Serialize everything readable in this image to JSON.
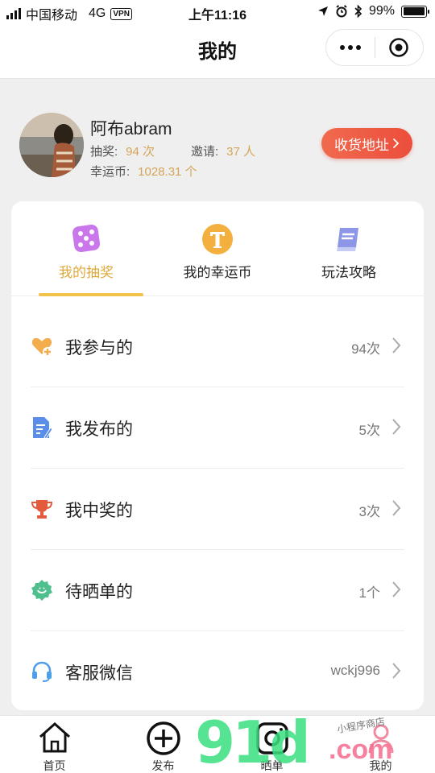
{
  "status_bar": {
    "carrier": "中国移动",
    "network": "4G",
    "vpn": "VPN",
    "time": "上午11:16",
    "battery": "99%",
    "battery_level": 0.99
  },
  "navbar": {
    "title": "我的"
  },
  "profile": {
    "name": "阿布abram",
    "draws_label": "抽奖:",
    "draws_value": "94 次",
    "invites_label": "邀请:",
    "invites_value": "37 人",
    "coins_label": "幸运币:",
    "coins_value": "1028.31 个",
    "address_button": "收货地址"
  },
  "tabs": [
    {
      "label": "我的抽奖",
      "icon": "dice-icon",
      "active": true
    },
    {
      "label": "我的幸运币",
      "icon": "coin-t-icon",
      "active": false
    },
    {
      "label": "玩法攻略",
      "icon": "book-icon",
      "active": false
    }
  ],
  "rows": [
    {
      "label": "我参与的",
      "value": "94次",
      "icon": "heart-plus-icon"
    },
    {
      "label": "我发布的",
      "value": "5次",
      "icon": "document-edit-icon"
    },
    {
      "label": "我中奖的",
      "value": "3次",
      "icon": "trophy-icon"
    },
    {
      "label": "待晒单的",
      "value": "1个",
      "icon": "smile-badge-icon"
    },
    {
      "label": "客服微信",
      "value": "wckj996",
      "icon": "headset-icon"
    }
  ],
  "tabbar": [
    {
      "label": "首页",
      "icon": "home-icon"
    },
    {
      "label": "发布",
      "icon": "plus-circle-icon"
    },
    {
      "label": "晒单",
      "icon": "camera-icon"
    },
    {
      "label": "我的",
      "icon": "user-icon"
    }
  ],
  "watermark": {
    "main": "91d",
    "suffix": ".com",
    "note": "小程序商店"
  },
  "colors": {
    "accent_gold": "#e0a93c",
    "value_gold": "#d4a558",
    "address_red": "#ec4e3c",
    "underline": "#f2c34c"
  }
}
